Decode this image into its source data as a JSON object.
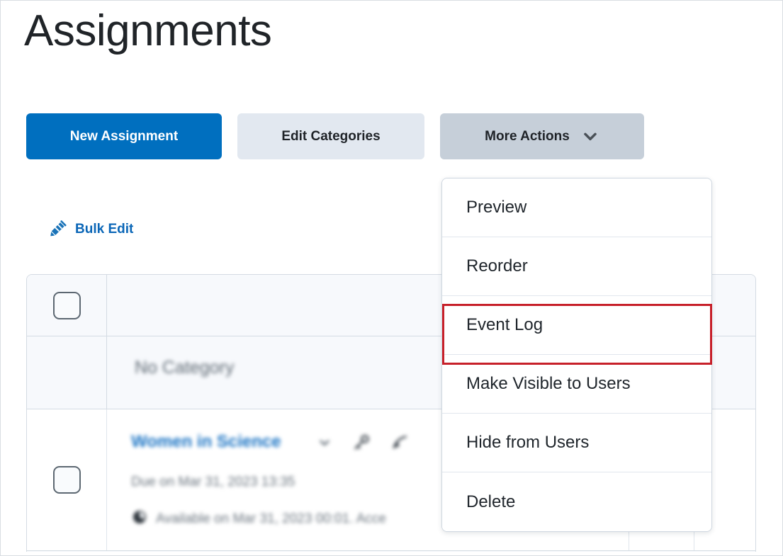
{
  "page": {
    "title": "Assignments"
  },
  "toolbar": {
    "new_assignment_label": "New Assignment",
    "edit_categories_label": "Edit Categories",
    "more_actions_label": "More Actions",
    "accent_color": "#006fbf",
    "secondary_color": "#e2e8f0",
    "tertiary_color": "#c6cfd9"
  },
  "bulk_edit": {
    "label": "Bulk Edit",
    "color": "#0a66b7"
  },
  "more_actions_menu": {
    "items": [
      {
        "label": "Preview"
      },
      {
        "label": "Reorder"
      },
      {
        "label": "Event Log"
      },
      {
        "label": "Make Visible to Users"
      },
      {
        "label": "Hide from Users"
      },
      {
        "label": "Delete"
      }
    ],
    "highlighted_item": "Event Log",
    "highlight_color": "#c7202a"
  },
  "table": {
    "category_row": {
      "name": "No Category"
    },
    "assignment_row": {
      "title": "Women in Science",
      "due": "Due on Mar 31, 2023 13:35",
      "availability": "Available on Mar 31, 2023 00:01. Acce"
    }
  }
}
